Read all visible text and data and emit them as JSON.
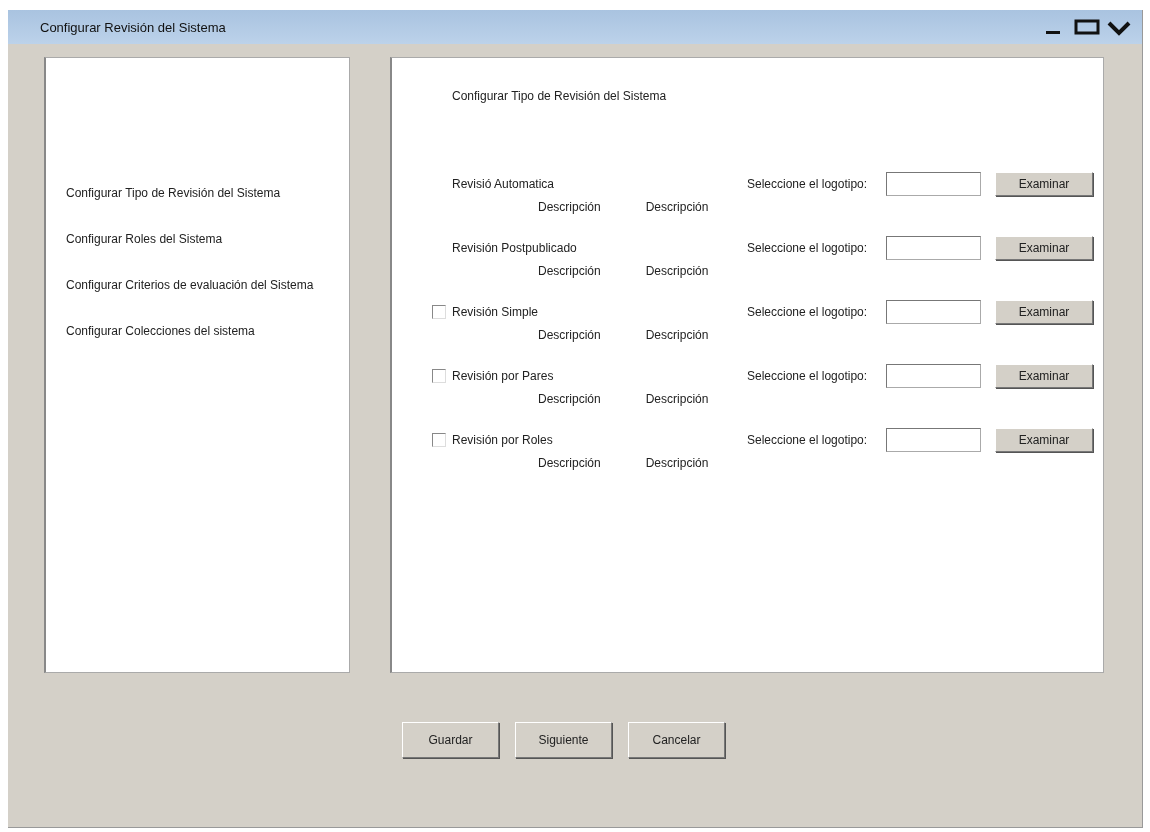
{
  "window": {
    "title": "Configurar Revisión del Sistema"
  },
  "sidebar": {
    "items": [
      {
        "label": "Configurar Tipo de Revisión del Sistema"
      },
      {
        "label": "Configurar Roles del Sistema"
      },
      {
        "label": "Configurar Criterios de evaluación del Sistema"
      },
      {
        "label": "Configurar Colecciones del sistema"
      }
    ]
  },
  "content": {
    "heading": "Configurar Tipo de Revisión del Sistema",
    "review_types": [
      {
        "kind": "plain",
        "label": "Revisió Automatica",
        "logo_label": "Seleccione el logotipo:",
        "browse_button": "Examinar",
        "descriptions": [
          "Descripción",
          "Descripción"
        ]
      },
      {
        "kind": "plain",
        "label": "Revisión Postpublicado",
        "logo_label": "Seleccione el logotipo:",
        "browse_button": "Examinar",
        "descriptions": [
          "Descripción",
          "Descripción"
        ]
      },
      {
        "kind": "checkbox",
        "checked": false,
        "label": "Revisión Simple",
        "logo_label": "Seleccione el logotipo:",
        "browse_button": "Examinar",
        "descriptions": [
          "Descripción",
          "Descripción"
        ]
      },
      {
        "kind": "checkbox",
        "checked": false,
        "label": "Revisión por Pares",
        "logo_label": "Seleccione el logotipo:",
        "browse_button": "Examinar",
        "descriptions": [
          "Descripción",
          "Descripción"
        ]
      },
      {
        "kind": "checkbox",
        "checked": false,
        "label": "Revisión por Roles",
        "logo_label": "Seleccione el logotipo:",
        "browse_button": "Examinar",
        "descriptions": [
          "Descripción",
          "Descripción"
        ]
      }
    ]
  },
  "buttons": [
    {
      "label": "Guardar"
    },
    {
      "label": "Siguiente"
    },
    {
      "label": "Cancelar"
    }
  ]
}
